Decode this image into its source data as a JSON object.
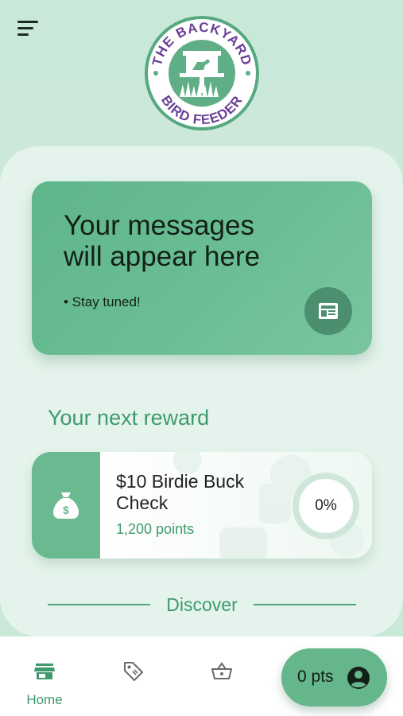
{
  "logo": {
    "top_text": "THE BACKYARD",
    "bottom_text": "BIRD FEEDER"
  },
  "message_card": {
    "title": "Your messages\nwill appear here",
    "bullet": "• Stay tuned!",
    "icon": "newspaper-icon"
  },
  "next_reward": {
    "section_title": "Your next reward",
    "name": "$10 Birdie Buck\nCheck",
    "points": "1,200 points",
    "progress_label": "0%",
    "progress_fraction": 0,
    "icon": "money-bag-icon"
  },
  "discover": {
    "label": "Discover"
  },
  "bottom_nav": {
    "items": [
      {
        "label": "Home",
        "icon": "store-icon",
        "active": true
      },
      {
        "label": "",
        "icon": "tag-icon",
        "active": false
      },
      {
        "label": "",
        "icon": "basket-icon",
        "active": false
      }
    ],
    "points_pill": {
      "label": "0 pts",
      "icon": "account-icon"
    }
  },
  "colors": {
    "brand_green": "#3e9a6c",
    "card_green": "#6ab991",
    "logo_purple": "#6a3f96"
  }
}
